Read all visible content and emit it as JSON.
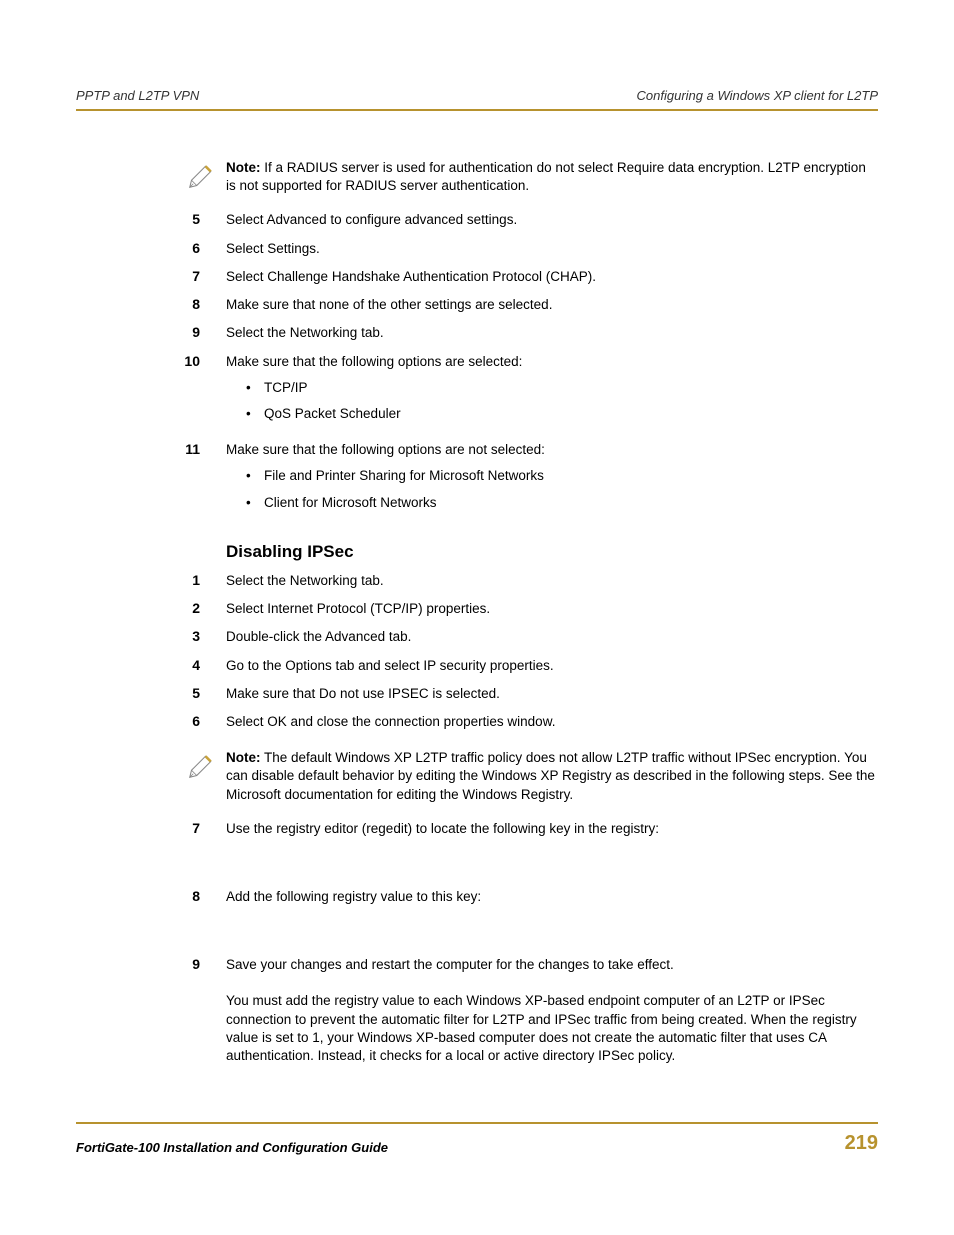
{
  "header": {
    "left": "PPTP and L2TP VPN",
    "right": "Configuring a Windows XP client for L2TP"
  },
  "note1": {
    "label": "Note:",
    "text": " If a RADIUS server is used for authentication do not select Require data encryption. L2TP encryption is not supported for RADIUS server authentication."
  },
  "stepsA": [
    {
      "num": "5",
      "text": "Select Advanced to configure advanced settings."
    },
    {
      "num": "6",
      "text": "Select Settings."
    },
    {
      "num": "7",
      "text": "Select Challenge Handshake Authentication Protocol (CHAP)."
    },
    {
      "num": "8",
      "text": "Make sure that none of the other settings are selected."
    },
    {
      "num": "9",
      "text": "Select the Networking tab."
    },
    {
      "num": "10",
      "text": "Make sure that the following options are selected:",
      "bullets": [
        "TCP/IP",
        "QoS Packet Scheduler"
      ]
    },
    {
      "num": "11",
      "text": "Make sure that the following options are not selected:",
      "bullets": [
        "File and Printer Sharing for Microsoft Networks",
        "Client for Microsoft Networks"
      ]
    }
  ],
  "section": {
    "heading": "Disabling IPSec"
  },
  "stepsB": [
    {
      "num": "1",
      "text": "Select the Networking tab."
    },
    {
      "num": "2",
      "text": "Select Internet Protocol (TCP/IP) properties."
    },
    {
      "num": "3",
      "text": "Double-click the Advanced tab."
    },
    {
      "num": "4",
      "text": "Go to the Options tab and select IP security properties."
    },
    {
      "num": "5",
      "text": "Make sure that Do not use IPSEC is selected."
    },
    {
      "num": "6",
      "text": "Select OK and close the connection properties window."
    }
  ],
  "note2": {
    "label": "Note:",
    "text": " The default Windows XP L2TP traffic policy does not allow L2TP traffic without IPSec encryption. You can disable default behavior by editing the Windows XP Registry as described in the following steps. See the Microsoft documentation for editing the Windows Registry."
  },
  "stepsC": [
    {
      "num": "7",
      "text": "Use the registry editor (regedit) to locate the following key in the registry:"
    },
    {
      "num": "8",
      "text": "Add the following registry value to this key:"
    },
    {
      "num": "9",
      "text": "Save your changes and restart the computer for the changes to take effect."
    }
  ],
  "closing": "You must add the                              registry value to each Windows XP-based endpoint computer of an L2TP or IPSec connection to prevent the automatic filter for L2TP and IPSec traffic from being created. When the                              registry value is set to 1, your Windows XP-based computer does not create the automatic filter that uses CA authentication. Instead, it checks for a local or active directory IPSec policy.",
  "footer": {
    "left": "FortiGate-100 Installation and Configuration Guide",
    "page": "219"
  }
}
